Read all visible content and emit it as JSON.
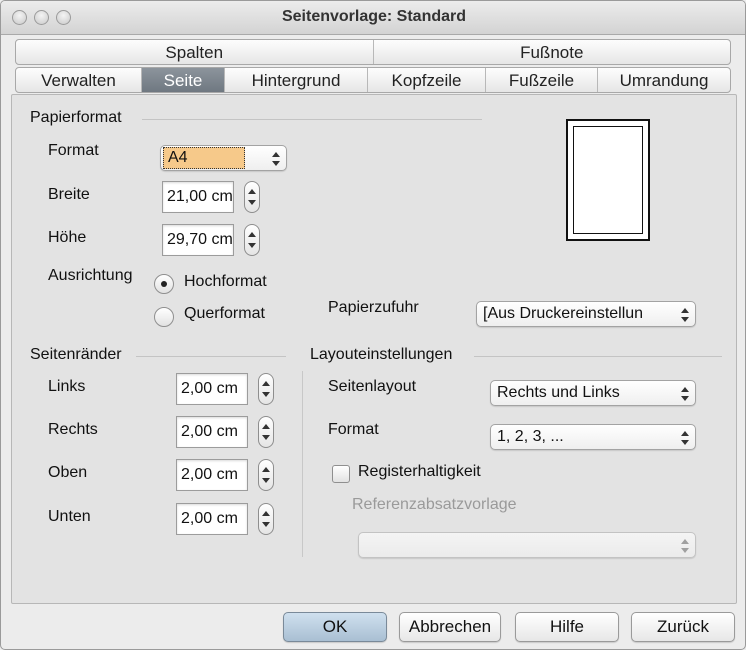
{
  "window": {
    "title": "Seitenvorlage: Standard"
  },
  "tabs": {
    "row1": [
      "Spalten",
      "Fußnote"
    ],
    "row2": [
      "Verwalten",
      "Seite",
      "Hintergrund",
      "Kopfzeile",
      "Fußzeile",
      "Umrandung"
    ],
    "active": "Seite"
  },
  "papierformat": {
    "heading": "Papierformat",
    "format_label": "Format",
    "format_value": "A4",
    "breite_label": "Breite",
    "breite_value": "21,00 cm",
    "hoehe_label": "Höhe",
    "hoehe_value": "29,70 cm",
    "ausrichtung_label": "Ausrichtung",
    "hochformat_label": "Hochformat",
    "querformat_label": "Querformat",
    "orientation_selected": "Hochformat",
    "papierzufuhr_label": "Papierzufuhr",
    "papierzufuhr_value": "[Aus Druckereinstellun"
  },
  "seitenraender": {
    "heading": "Seitenränder",
    "links_label": "Links",
    "links_value": "2,00 cm",
    "rechts_label": "Rechts",
    "rechts_value": "2,00 cm",
    "oben_label": "Oben",
    "oben_value": "2,00 cm",
    "unten_label": "Unten",
    "unten_value": "2,00 cm"
  },
  "layout": {
    "heading": "Layouteinstellungen",
    "seitenlayout_label": "Seitenlayout",
    "seitenlayout_value": "Rechts und Links",
    "format_label": "Format",
    "format_value": "1, 2, 3, ...",
    "registerhaltigkeit_label": "Registerhaltigkeit",
    "registerhaltigkeit_checked": false,
    "referenz_label": "Referenzabsatzvorlage",
    "referenz_value": ""
  },
  "buttons": {
    "ok": "OK",
    "abbrechen": "Abbrechen",
    "hilfe": "Hilfe",
    "zurueck": "Zurück"
  },
  "colors": {
    "active_tab": "#7a838c",
    "format_highlight": "#f6c98a",
    "default_button": "#b9cde0"
  }
}
